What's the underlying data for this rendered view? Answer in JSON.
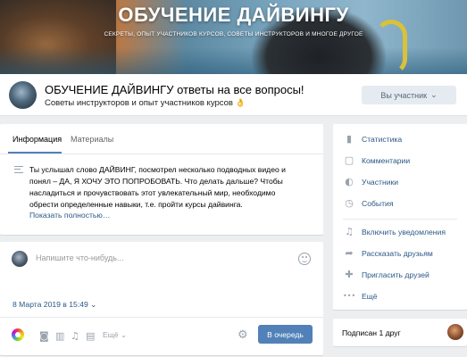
{
  "cover": {
    "title": "ОБУЧЕНИЕ ДАЙВИНГУ",
    "subtitle": "СЕКРЕТЫ, ОПЫТ УЧАСТНИКОВ КУРСОВ, СОВЕТЫ ИНСТРУКТОРОВ И МНОГОЕ ДРУГОЕ"
  },
  "header": {
    "name": "ОБУЧЕНИЕ ДАЙВИНГУ ответы на все вопросы!",
    "status": "Советы инструкторов и опыт участников курсов",
    "status_emoji": "👌",
    "member_button": "Вы участник",
    "member_chevron": "⌄"
  },
  "info": {
    "tabs": [
      "Информация",
      "Материалы"
    ],
    "text": "Ты услышал слово ДАЙВИНГ, посмотрел несколько подводных видео и понял – ДА, Я ХОЧУ ЭТО ПОПРОБОВАТЬ. Что делать дальше? Чтобы насладиться и прочувствовать этот увлекательный мир, необходимо обрести определенные навыки, т.е. пройти курсы дайвинга.",
    "show_more": "Показать полностью…"
  },
  "post": {
    "placeholder": "Напишите что-нибудь...",
    "date": "8 Марта 2019 в 15:49",
    "date_chevron": "⌄",
    "more_tools": "Ещё",
    "more_chevron": "⌄",
    "submit": "В очередь",
    "icons": [
      "palette-icon",
      "camera-icon",
      "video-icon",
      "music-icon",
      "document-icon",
      "gear-icon"
    ]
  },
  "menu": {
    "items": [
      {
        "label": "Статистика",
        "icon": "stats-icon",
        "glyph": "▮"
      },
      {
        "label": "Комментарии",
        "icon": "comment-icon",
        "glyph": "▢"
      },
      {
        "label": "Участники",
        "icon": "user-icon",
        "glyph": "◐"
      },
      {
        "label": "События",
        "icon": "events-icon",
        "glyph": "◷"
      },
      {
        "label": "Включить уведомления",
        "icon": "bell-icon",
        "glyph": "♫"
      },
      {
        "label": "Рассказать друзьям",
        "icon": "share-icon",
        "glyph": "➦"
      },
      {
        "label": "Пригласить друзей",
        "icon": "invite-icon",
        "glyph": "✚"
      },
      {
        "label": "Ещё",
        "icon": "more-icon",
        "glyph": "•••"
      }
    ]
  },
  "subscribers": {
    "label": "Подписан 1 друг"
  },
  "colors": {
    "accent": "#5181b8",
    "link": "#2a5885",
    "background": "#edeef0"
  }
}
